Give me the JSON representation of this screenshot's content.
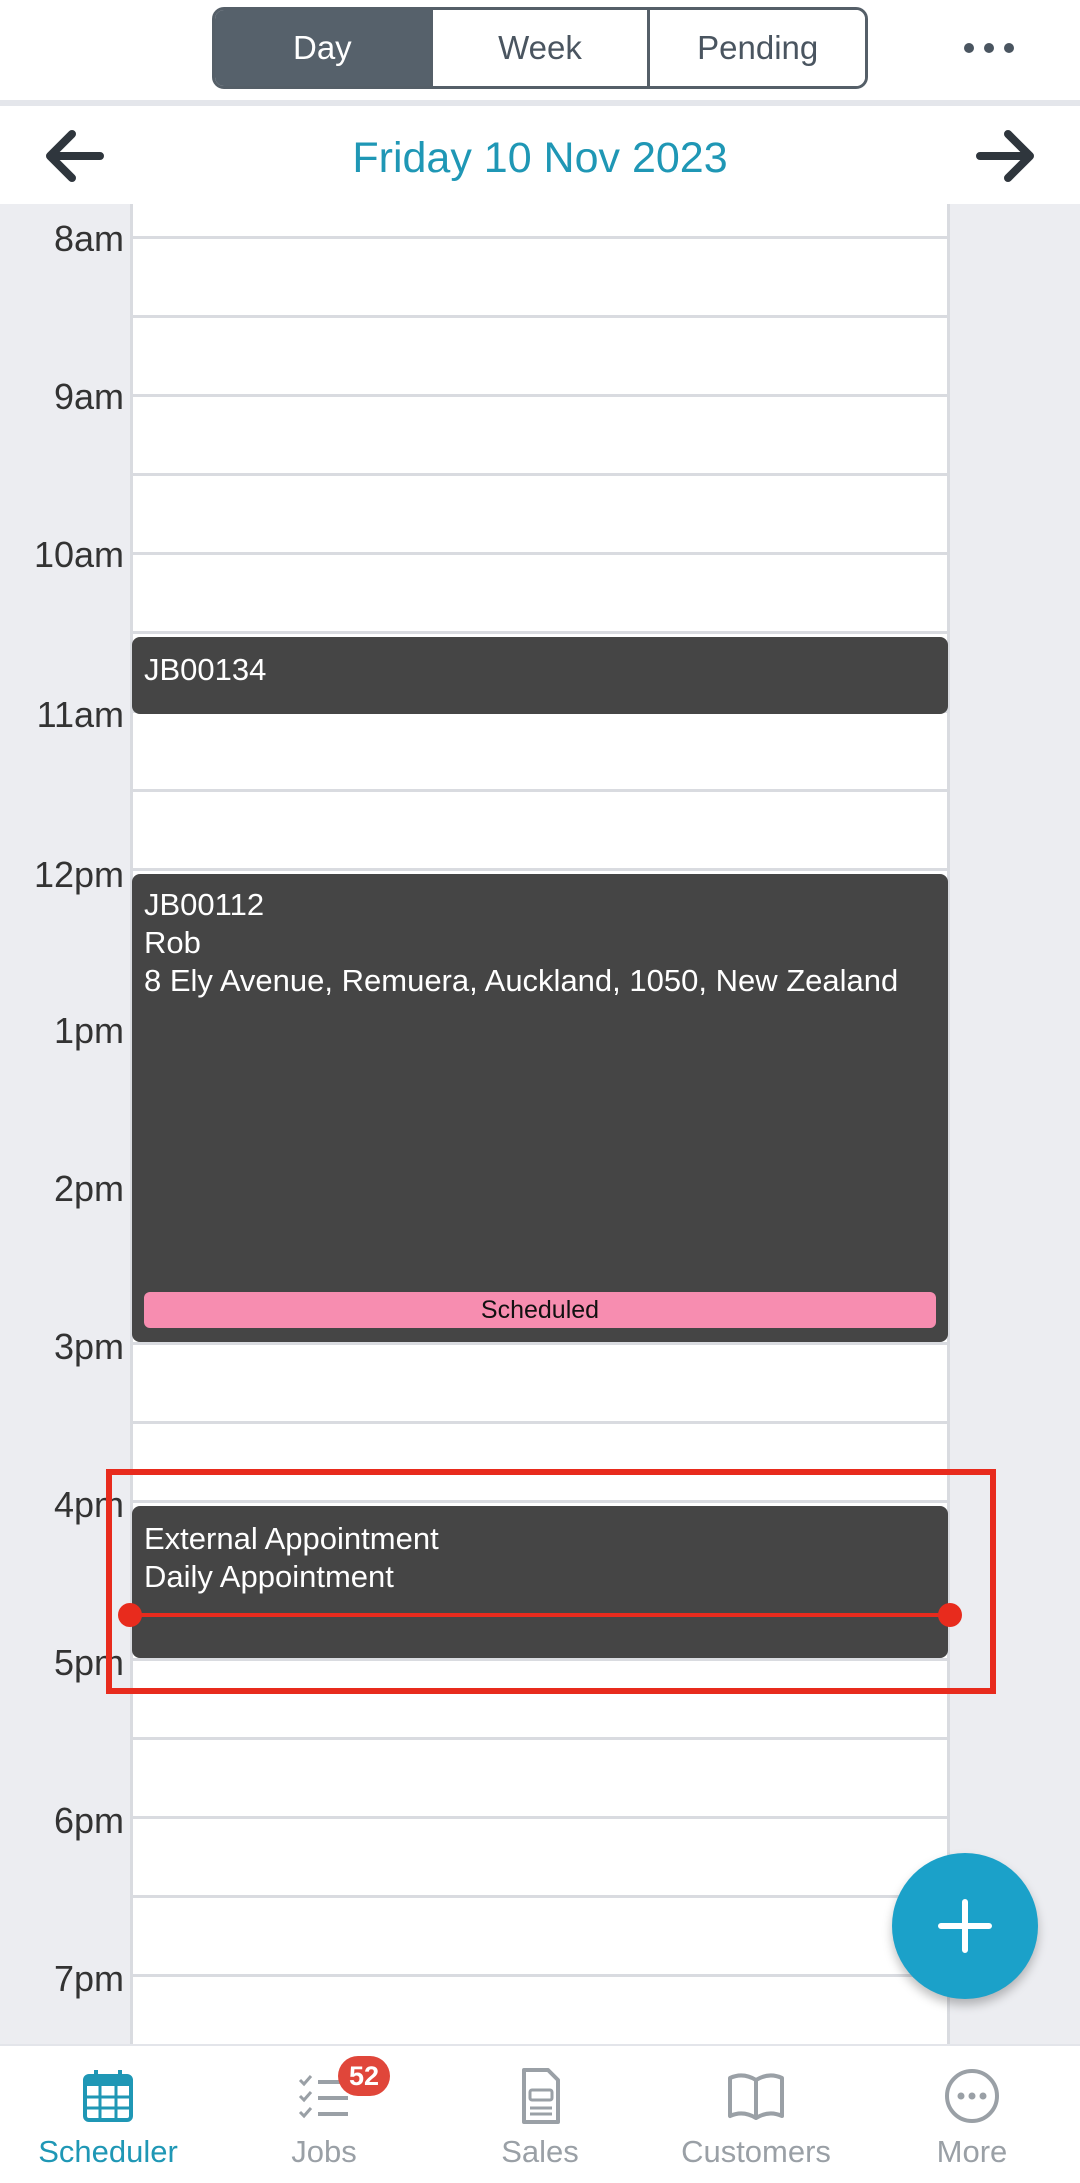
{
  "view_tabs": [
    {
      "label": "Day",
      "active": true
    },
    {
      "label": "Week",
      "active": false
    },
    {
      "label": "Pending",
      "active": false
    }
  ],
  "header": {
    "date_title": "Friday 10 Nov 2023"
  },
  "hours": [
    "8am",
    "9am",
    "10am",
    "11am",
    "12pm",
    "1pm",
    "2pm",
    "3pm",
    "4pm",
    "5pm",
    "6pm",
    "7pm"
  ],
  "events": [
    {
      "id": "JB00134",
      "lines": [
        "JB00134"
      ]
    },
    {
      "id": "JB00112",
      "lines": [
        "JB00112",
        "Rob",
        "8 Ely Avenue, Remuera, Auckland, 1050, New Zealand"
      ],
      "status": "Scheduled",
      "status_color": "#f78db0"
    },
    {
      "id": "external",
      "lines": [
        "External Appointment",
        "Daily Appointment"
      ]
    }
  ],
  "nav": {
    "items": [
      {
        "label": "Scheduler",
        "icon": "calendar-icon",
        "active": true
      },
      {
        "label": "Jobs",
        "icon": "checklist-icon",
        "badge": "52"
      },
      {
        "label": "Sales",
        "icon": "document-icon"
      },
      {
        "label": "Customers",
        "icon": "book-icon"
      },
      {
        "label": "More",
        "icon": "more-circle-icon"
      }
    ]
  },
  "colors": {
    "accent": "#1f97b5",
    "event_bg": "#454545",
    "highlight": "#e82b1d",
    "fab": "#1ba1c9"
  }
}
